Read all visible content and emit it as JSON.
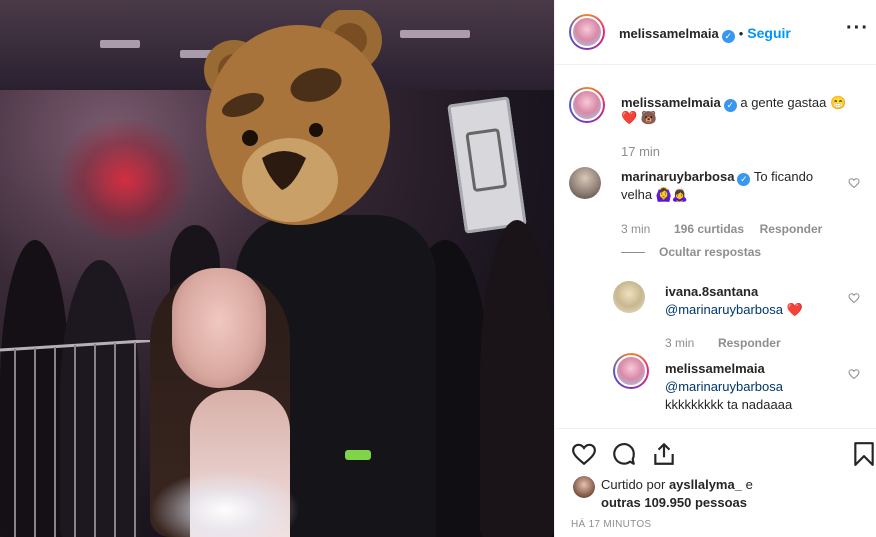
{
  "header": {
    "username": "melissamelmaia",
    "follow_label": "Seguir",
    "separator": "•",
    "more_label": "•••"
  },
  "caption": {
    "username": "melissamelmaia",
    "text": "a gente gastaa 😁",
    "emoji_line": "❤️ 🐻",
    "time": "17 min"
  },
  "comments": [
    {
      "username": "marinaruybarbosa",
      "text_line1": "To ficando",
      "text_line2": "velha 🙆‍♀️🙇‍♀️",
      "time": "3 min",
      "likes": "196 curtidas",
      "reply_label": "Responder",
      "hide_replies_label": "Ocultar respostas"
    }
  ],
  "replies": [
    {
      "username": "ivana.8santana",
      "mention": "@marinaruybarbosa",
      "text": "❤️",
      "time": "3 min",
      "reply_label": "Responder"
    },
    {
      "username": "melissamelmaia",
      "mention": "@marinaruybarbosa",
      "text": "kkkkkkkkk ta nadaaaa"
    }
  ],
  "likes": {
    "prefix": "Curtido por",
    "user": "aysllalyma_",
    "conj": "e",
    "others": "outras 109.950 pessoas"
  },
  "timestamp": "HÁ 17 MINUTOS",
  "colors": {
    "accent": "#0095f6",
    "verified": "#3897f0",
    "muted": "#8e8e8e",
    "text": "#262626"
  }
}
